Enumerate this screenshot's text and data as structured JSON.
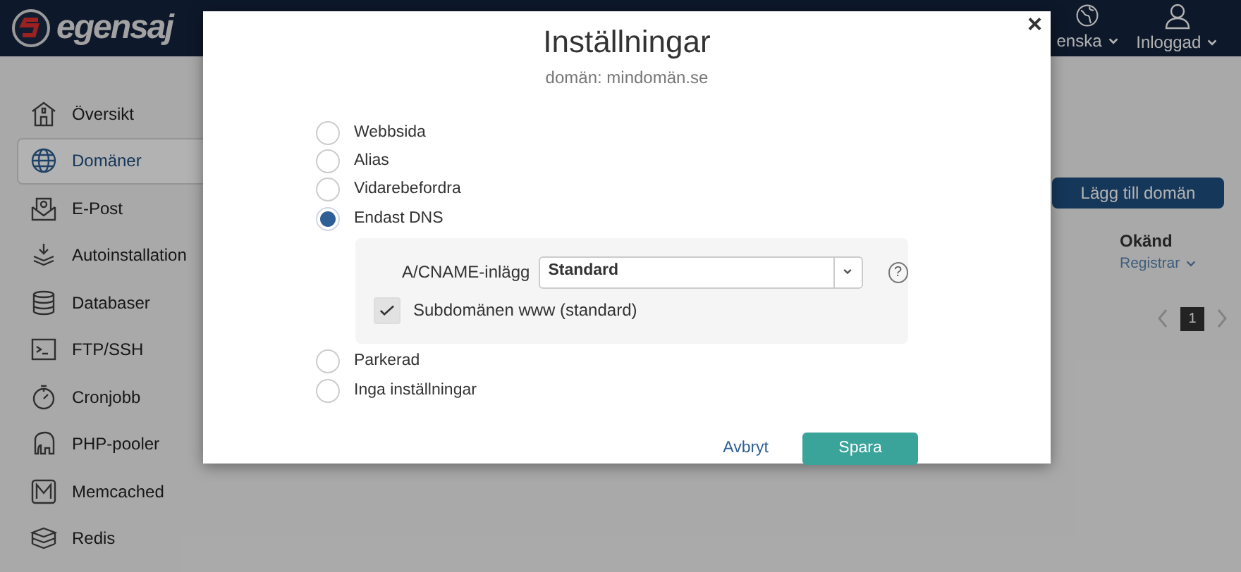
{
  "header": {
    "logo": "egensaj",
    "language": "enska",
    "account": "Inloggad"
  },
  "sidebar": {
    "items": [
      {
        "label": "Översikt",
        "selected": false
      },
      {
        "label": "Domäner",
        "selected": true
      },
      {
        "label": "E-Post",
        "selected": false
      },
      {
        "label": "Autoinstallation",
        "selected": false
      },
      {
        "label": "Databaser",
        "selected": false
      },
      {
        "label": "FTP/SSH",
        "selected": false
      },
      {
        "label": "Cronjobb",
        "selected": false
      },
      {
        "label": "PHP-pooler",
        "selected": false
      },
      {
        "label": "Memcached",
        "selected": false
      },
      {
        "label": "Redis",
        "selected": false
      }
    ]
  },
  "content": {
    "add_button": "Lägg till domän",
    "column_heading": "Okänd",
    "registrar_link": "Registrar",
    "pages": [
      {
        "label": "1",
        "selected": true
      }
    ]
  },
  "dialog": {
    "title": "Inställningar",
    "subtitle": "domän: mindomän.se",
    "close": "×",
    "options": [
      {
        "label": "Webbsida",
        "selected": false
      },
      {
        "label": "Alias",
        "selected": false
      },
      {
        "label": "Vidarebefordra",
        "selected": false
      },
      {
        "label": "Endast DNS",
        "selected": true
      },
      {
        "label": "Parkerad",
        "selected": false
      },
      {
        "label": "Inga inställningar",
        "selected": false
      }
    ],
    "dns_settings": {
      "label": "A/CNAME-inlägg",
      "value": "Standard",
      "help": "?",
      "www_checkbox": {
        "label": "Subdomänen www (standard)",
        "checked": true
      }
    },
    "cancel": "Avbryt",
    "save": "Spara"
  }
}
